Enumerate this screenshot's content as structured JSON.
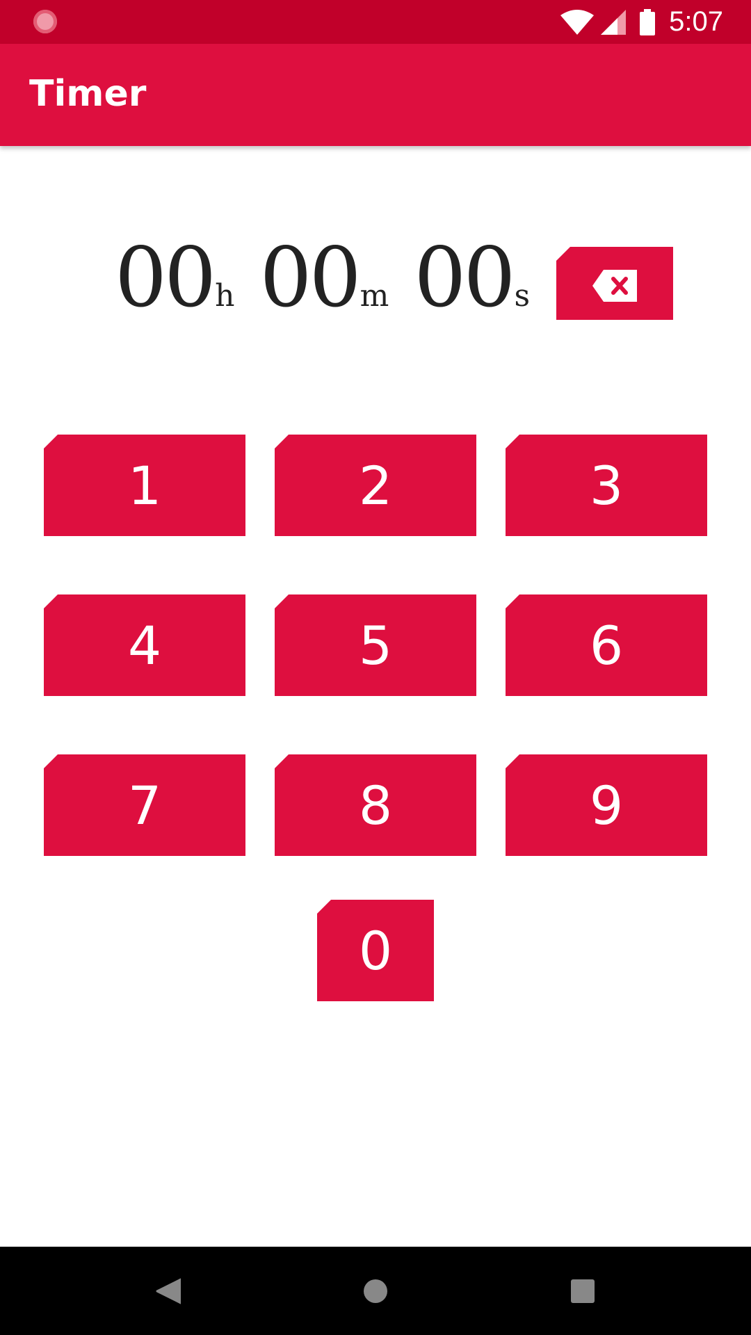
{
  "status_bar": {
    "time": "5:07",
    "icons": [
      "loading-spinner-icon",
      "wifi-icon",
      "signal-icon",
      "battery-icon"
    ]
  },
  "app_bar": {
    "title": "Timer"
  },
  "timer": {
    "hours": "00",
    "hours_unit": "h",
    "minutes": "00",
    "minutes_unit": "m",
    "seconds": "00",
    "seconds_unit": "s"
  },
  "backspace": {
    "icon": "backspace-icon"
  },
  "keypad": {
    "keys": [
      "1",
      "2",
      "3",
      "4",
      "5",
      "6",
      "7",
      "8",
      "9",
      "0"
    ]
  },
  "nav_bar": {
    "icons": [
      "back-icon",
      "home-icon",
      "recents-icon"
    ]
  },
  "colors": {
    "accent": "#DE0F3F",
    "status_bar": "#C1002A",
    "text_dark": "#222222",
    "nav_bar": "#000000"
  }
}
